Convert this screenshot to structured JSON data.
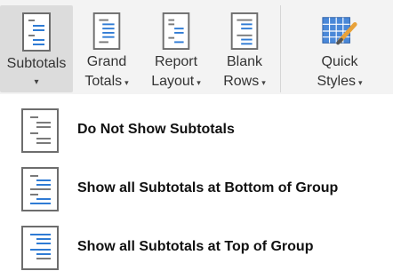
{
  "ribbon": {
    "subtotals": {
      "label": "Subtotals",
      "caret": "▾"
    },
    "grand_totals": {
      "label_line1": "Grand",
      "label_line2": "Totals",
      "caret": "▾"
    },
    "report_layout": {
      "label_line1": "Report",
      "label_line2": "Layout",
      "caret": "▾"
    },
    "blank_rows": {
      "label_line1": "Blank",
      "label_line2": "Rows",
      "caret": "▾"
    },
    "quick_styles": {
      "label_line1": "Quick",
      "label_line2": "Styles",
      "caret": "▾"
    }
  },
  "menu": {
    "items": [
      {
        "label": "Do Not Show Subtotals",
        "icon": "no-subtotals-icon"
      },
      {
        "label": "Show all Subtotals at Bottom of Group",
        "icon": "subtotals-bottom-icon"
      },
      {
        "label": "Show all Subtotals at Top of Group",
        "icon": "subtotals-top-icon"
      }
    ]
  },
  "colors": {
    "accent_blue": "#2f7bd4",
    "icon_gray": "#7a7a7a",
    "ribbon_bg": "#f3f3f3",
    "selected_bg": "#dcdcdc"
  }
}
